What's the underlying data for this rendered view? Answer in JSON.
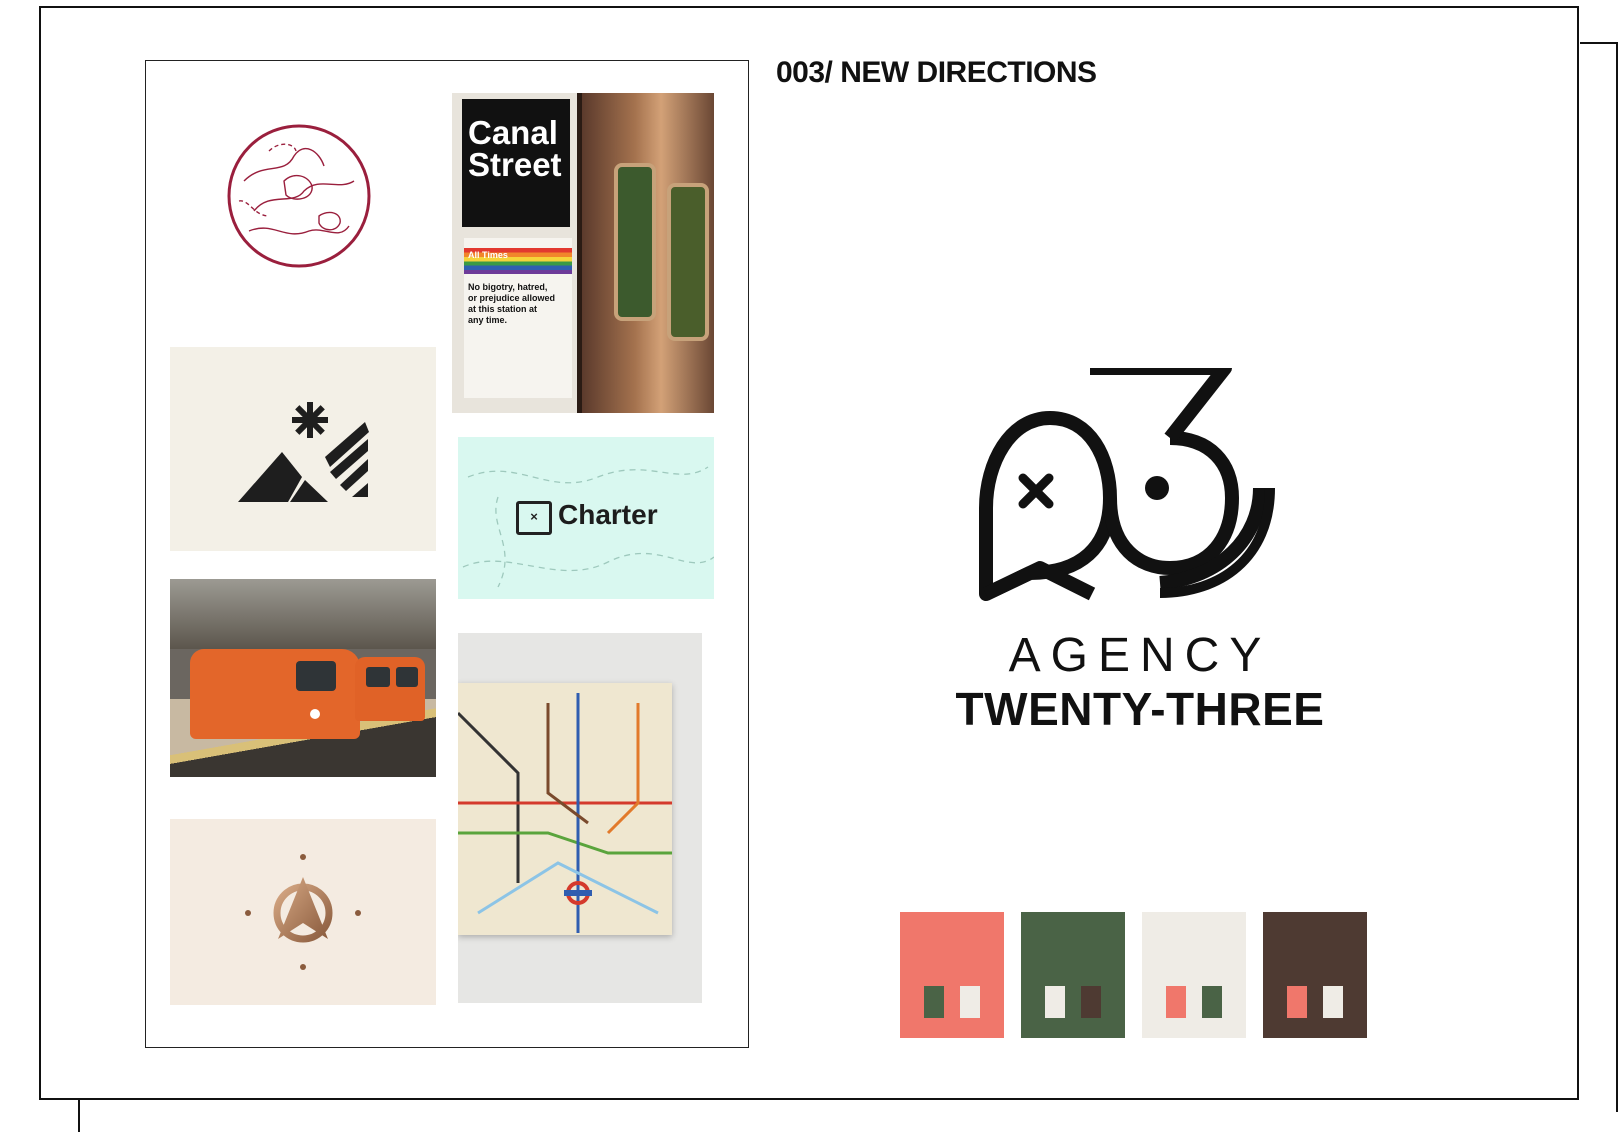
{
  "heading": "003/ NEW DIRECTIONS",
  "brand": {
    "line1": "AGENCY",
    "line2": "TWENTY-THREE"
  },
  "moodboard": {
    "charter_label": "Charter",
    "sign_line1": "Canal",
    "sign_line2": "Street",
    "notice_title": "All Times",
    "notice_text_1": "No bigotry, hatred,",
    "notice_text_2": "or prejudice allowed",
    "notice_text_3": "at this station at",
    "notice_text_4": "any time."
  },
  "palette": [
    {
      "bg": "#f0776b",
      "chips": [
        "#4a6346",
        "#efece6"
      ]
    },
    {
      "bg": "#4a6346",
      "chips": [
        "#efece6",
        "#4e3a32"
      ]
    },
    {
      "bg": "#efece6",
      "chips": [
        "#f0776b",
        "#4a6346"
      ]
    },
    {
      "bg": "#4e3a32",
      "chips": [
        "#f0776b",
        "#efece6"
      ]
    }
  ]
}
